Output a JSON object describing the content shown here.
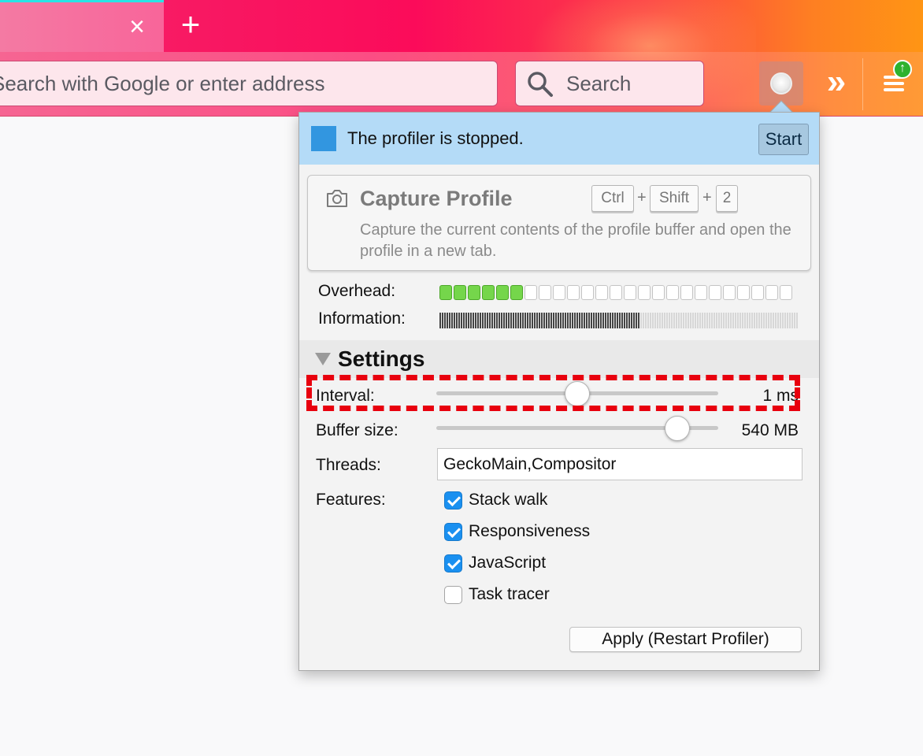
{
  "browser": {
    "tab_close_glyph": "×",
    "new_tab_glyph": "+",
    "urlbar_placeholder": "Search with Google or enter address",
    "searchbar_placeholder": "Search",
    "overflow_glyph": "»",
    "update_badge_glyph": "↑",
    "accent_tab_color": "#28e4e6"
  },
  "profiler": {
    "status": {
      "text": "The profiler is stopped.",
      "start_label": "Start",
      "color": "#3296e0"
    },
    "capture": {
      "title": "Capture Profile",
      "shortcut": [
        "Ctrl",
        "Shift",
        "2"
      ],
      "plus": "+",
      "description": "Capture the current contents of the profile buffer and open the profile in a new tab."
    },
    "meters": {
      "overhead_label": "Overhead:",
      "overhead_level": 6,
      "overhead_total": 25,
      "information_label": "Information:",
      "information_fraction": 0.56
    },
    "settings": {
      "title": "Settings",
      "interval": {
        "label": "Interval:",
        "value": "1 ms",
        "fraction": 0.5
      },
      "buffer_size": {
        "label": "Buffer size:",
        "value": "540 MB",
        "fraction": 0.89
      },
      "threads": {
        "label": "Threads:",
        "value": "GeckoMain,Compositor"
      },
      "features": {
        "label": "Features:",
        "items": [
          {
            "label": "Stack walk",
            "checked": true
          },
          {
            "label": "Responsiveness",
            "checked": true
          },
          {
            "label": "JavaScript",
            "checked": true
          },
          {
            "label": "Task tracer",
            "checked": false
          }
        ]
      },
      "apply_label": "Apply (Restart Profiler)"
    }
  },
  "annotation": {
    "highlight_color": "#e8000e"
  }
}
